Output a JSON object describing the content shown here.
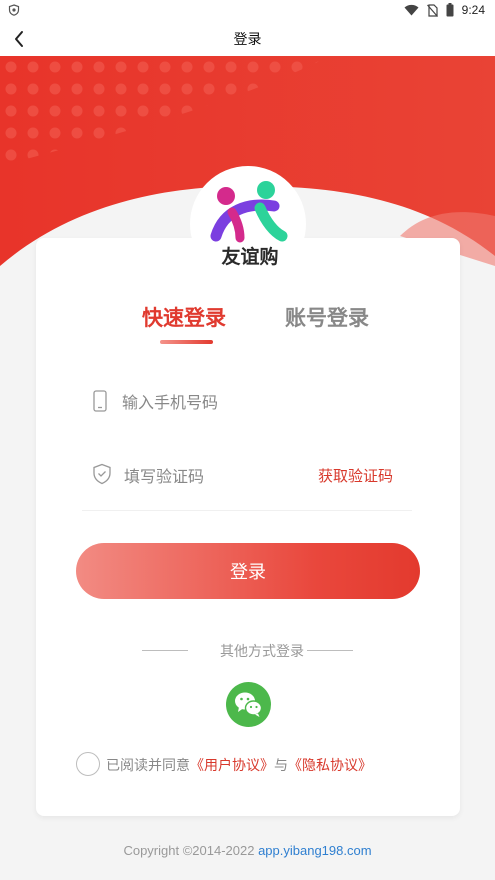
{
  "status_bar": {
    "time": "9:24",
    "icons": [
      "shield-icon",
      "wifi-icon",
      "no-sim-icon",
      "battery-icon"
    ]
  },
  "nav": {
    "title": "登录",
    "back_icon": "chevron-left-icon"
  },
  "colors": {
    "brand_red": "#e33a2e",
    "link_red": "#d8392c",
    "wechat_green": "#4cb84b",
    "link_blue": "#2f7fd0"
  },
  "logo": {
    "text": "友谊购"
  },
  "tabs": [
    {
      "label": "快速登录",
      "active": true
    },
    {
      "label": "账号登录",
      "active": false
    }
  ],
  "form": {
    "phone_placeholder": "输入手机号码",
    "code_placeholder": "填写验证码",
    "get_code_label": "获取验证码",
    "login_label": "登录"
  },
  "other_login": {
    "label": "其他方式登录",
    "icon": "wechat-icon"
  },
  "agreement": {
    "prefix": "已阅读并同意",
    "user_agreement": "《用户协议》",
    "joiner": "与",
    "privacy_agreement": "《隐私协议》"
  },
  "footer": {
    "copyright": "Copyright ©2014-2022 ",
    "domain": "app.yibang198.com"
  }
}
